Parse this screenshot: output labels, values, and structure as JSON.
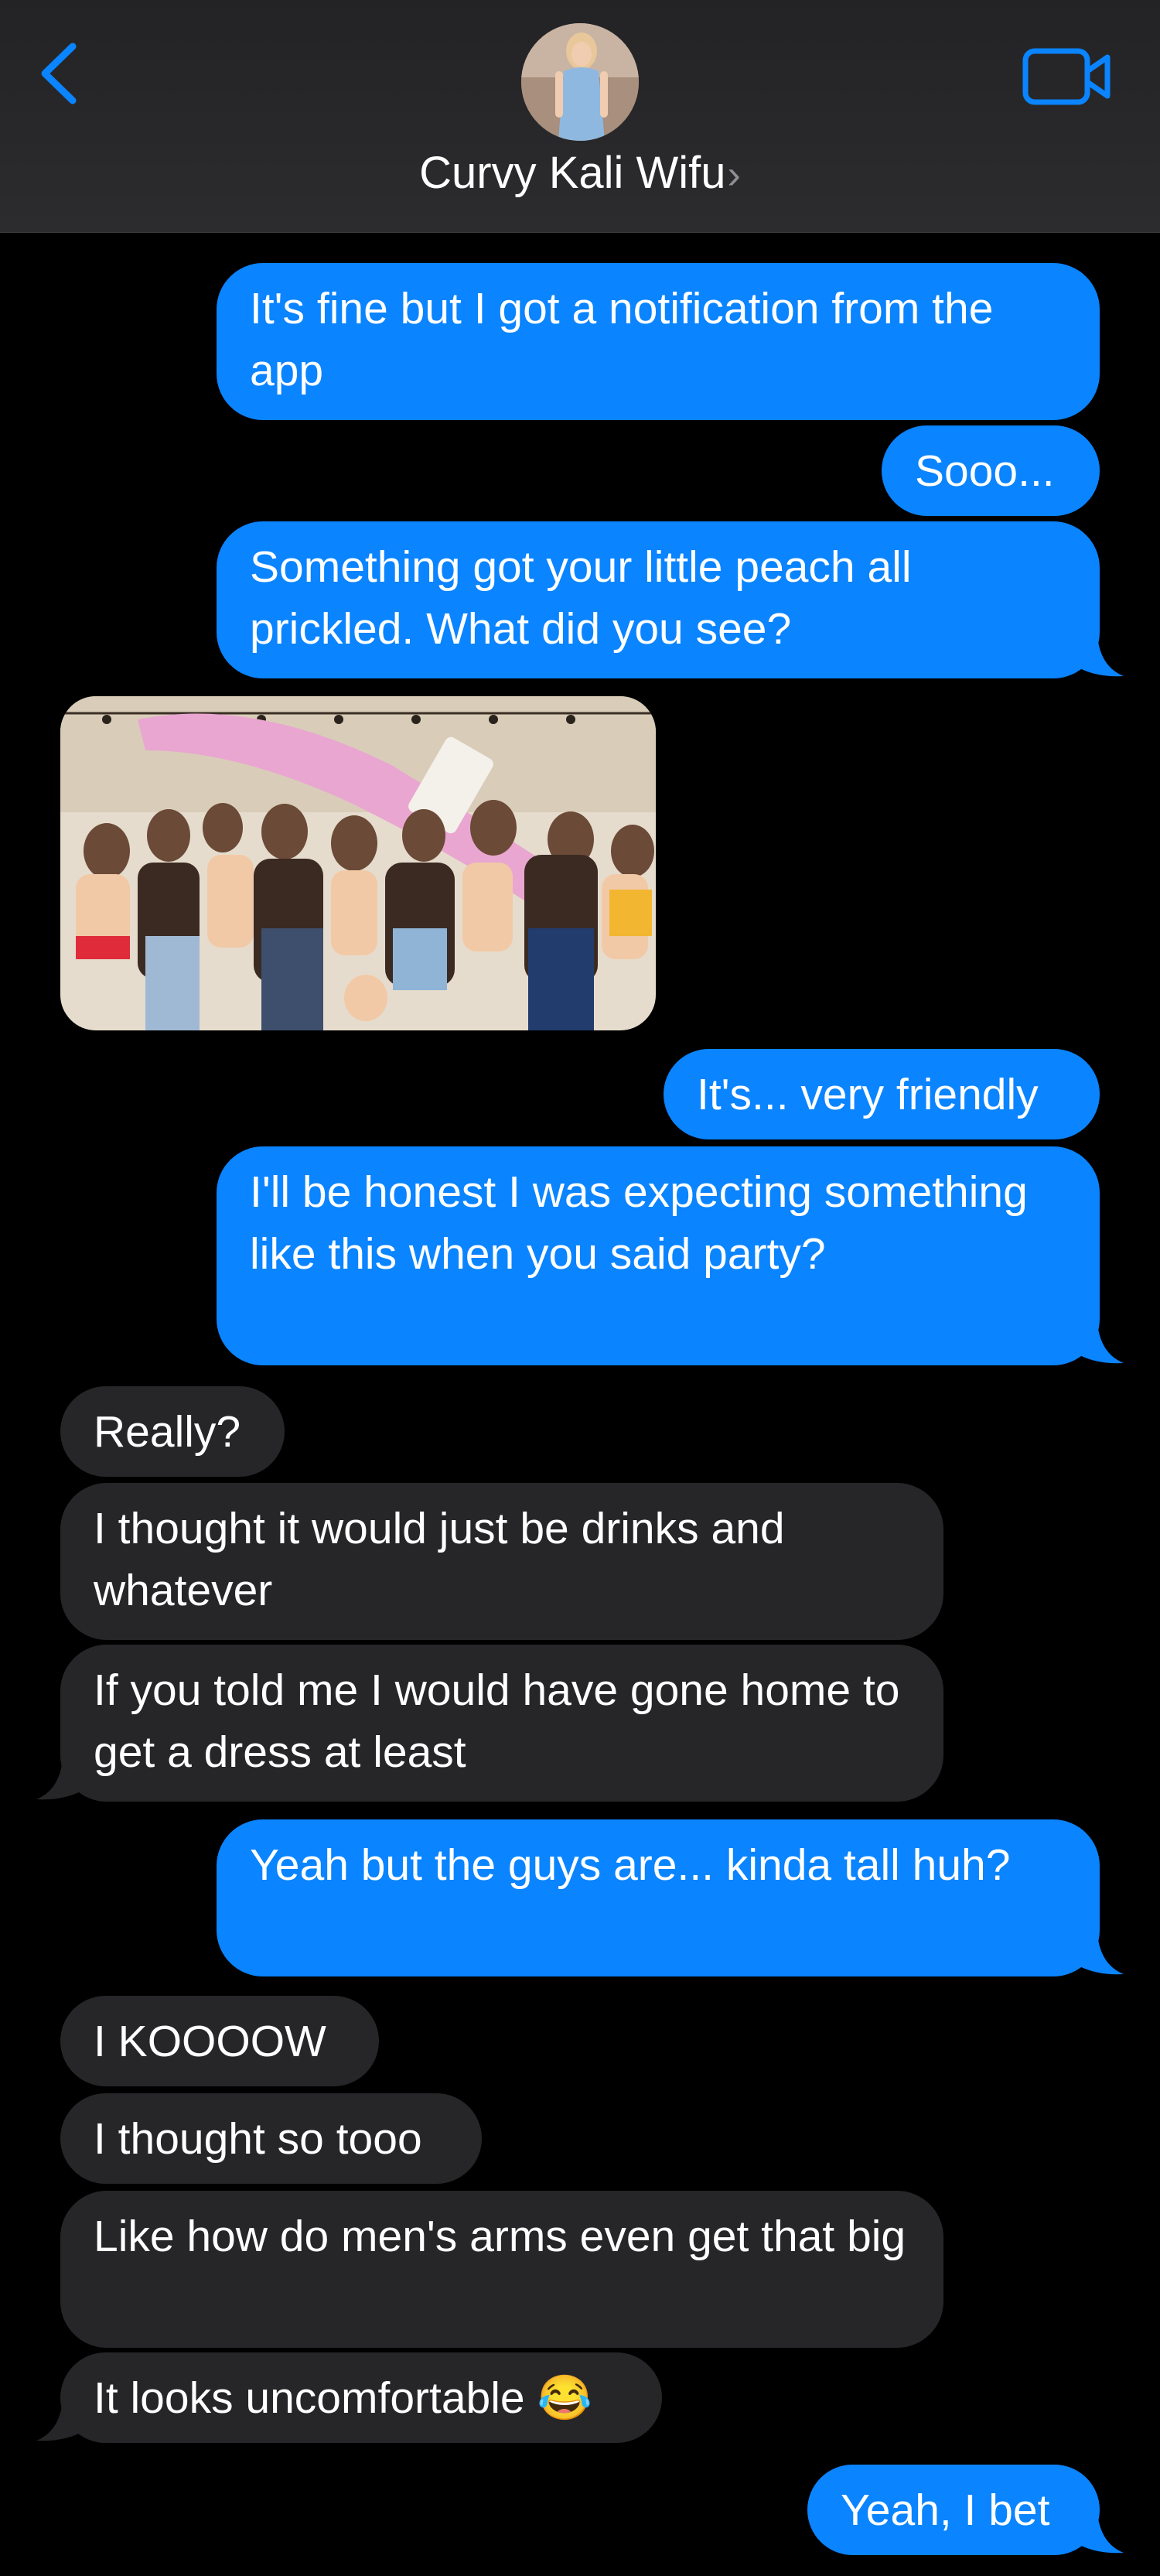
{
  "header": {
    "contact_name": "Curvy Kali Wifu",
    "chevron": "›",
    "back_icon": "chevron-left-icon",
    "video_icon": "video-camera-icon",
    "accent_color": "#0a84ff"
  },
  "colors": {
    "sent_bubble": "#0a84ff",
    "received_bubble": "#262628",
    "background": "#000000"
  },
  "messages": [
    {
      "from": "me",
      "text": "It's fine but I got a notification from the app"
    },
    {
      "from": "me",
      "text": "Sooo..."
    },
    {
      "from": "me",
      "text": "Something got your little peach all prickled. What did you see?"
    },
    {
      "from": "them",
      "type": "image",
      "alt_name": "party-photo"
    },
    {
      "from": "me",
      "text": "It's... very friendly"
    },
    {
      "from": "me",
      "text": "I'll be honest I was expecting something like this when you said party?"
    },
    {
      "from": "them",
      "text": "Really?"
    },
    {
      "from": "them",
      "text": "I thought it would just be drinks and whatever"
    },
    {
      "from": "them",
      "text": "If you told me I would have gone home to get a dress at least"
    },
    {
      "from": "me",
      "text": "Yeah but the guys are... kinda tall huh?"
    },
    {
      "from": "them",
      "text": "I KOOOOW"
    },
    {
      "from": "them",
      "text": "I thought so tooo"
    },
    {
      "from": "them",
      "text": "Like how do men's arms even get that big"
    },
    {
      "from": "them",
      "text": "It looks uncomfortable 😂"
    },
    {
      "from": "me",
      "text": "Yeah, I bet"
    }
  ]
}
